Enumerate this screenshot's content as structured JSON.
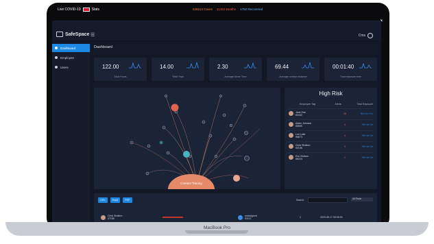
{
  "covid": {
    "title": "Live COVID-19",
    "region": "Stats",
    "cases": "238513 Cases",
    "deaths": "41381 Deaths",
    "recovered": "1750 Recovered",
    "close": "×"
  },
  "app": {
    "logo": "SafeSpace",
    "user": "Cms"
  },
  "sidebar": {
    "items": [
      {
        "label": "Dashboard"
      },
      {
        "label": "Employee"
      },
      {
        "label": "Users"
      }
    ]
  },
  "main": {
    "title": "Dashboard"
  },
  "stats": [
    {
      "value": "122.00",
      "label": "Total Hours"
    },
    {
      "value": "14.00",
      "label": "Total Trips"
    },
    {
      "value": "2.30",
      "label": "Average Alone Time"
    },
    {
      "value": "69.44",
      "label": "Average contact distance"
    },
    {
      "value": "00:01:40",
      "label": "Total exposure time"
    }
  ],
  "network": {
    "center_label": "Contact Tracing"
  },
  "highrisk": {
    "title": "High Risk",
    "headers": [
      "Employee Tag",
      "Alerts",
      "Total Exposure"
    ],
    "rows": [
      {
        "name": "Jane Doe",
        "id": "60442",
        "alerts": "48",
        "exposure": "00h 0m 47s"
      },
      {
        "name": "Adam Johnson",
        "id": "66669",
        "alerts": "4",
        "exposure": "00h 0m 0s"
      },
      {
        "name": "Lori Lake",
        "id": "96673",
        "alerts": "4",
        "exposure": "00h 0m 0s"
      },
      {
        "name": "Chris Stratton",
        "id": "52108",
        "alerts": "3",
        "exposure": "00h 0m 0s"
      },
      {
        "name": "Eve Vickson",
        "id": "66224",
        "alerts": "2",
        "exposure": "00h 0m 0s"
      }
    ]
  },
  "table": {
    "buttons": [
      "CSV",
      "Excel",
      "PDF"
    ],
    "search_label": "Search:",
    "filter": "All Flows",
    "row": {
      "name": "Chris Stratton",
      "id": "67188",
      "contact": "unassigned",
      "contact_id": "83112",
      "count": "1",
      "time": "2020-06-17 00:05:23"
    }
  },
  "device": {
    "label": "MacBook Pro"
  }
}
